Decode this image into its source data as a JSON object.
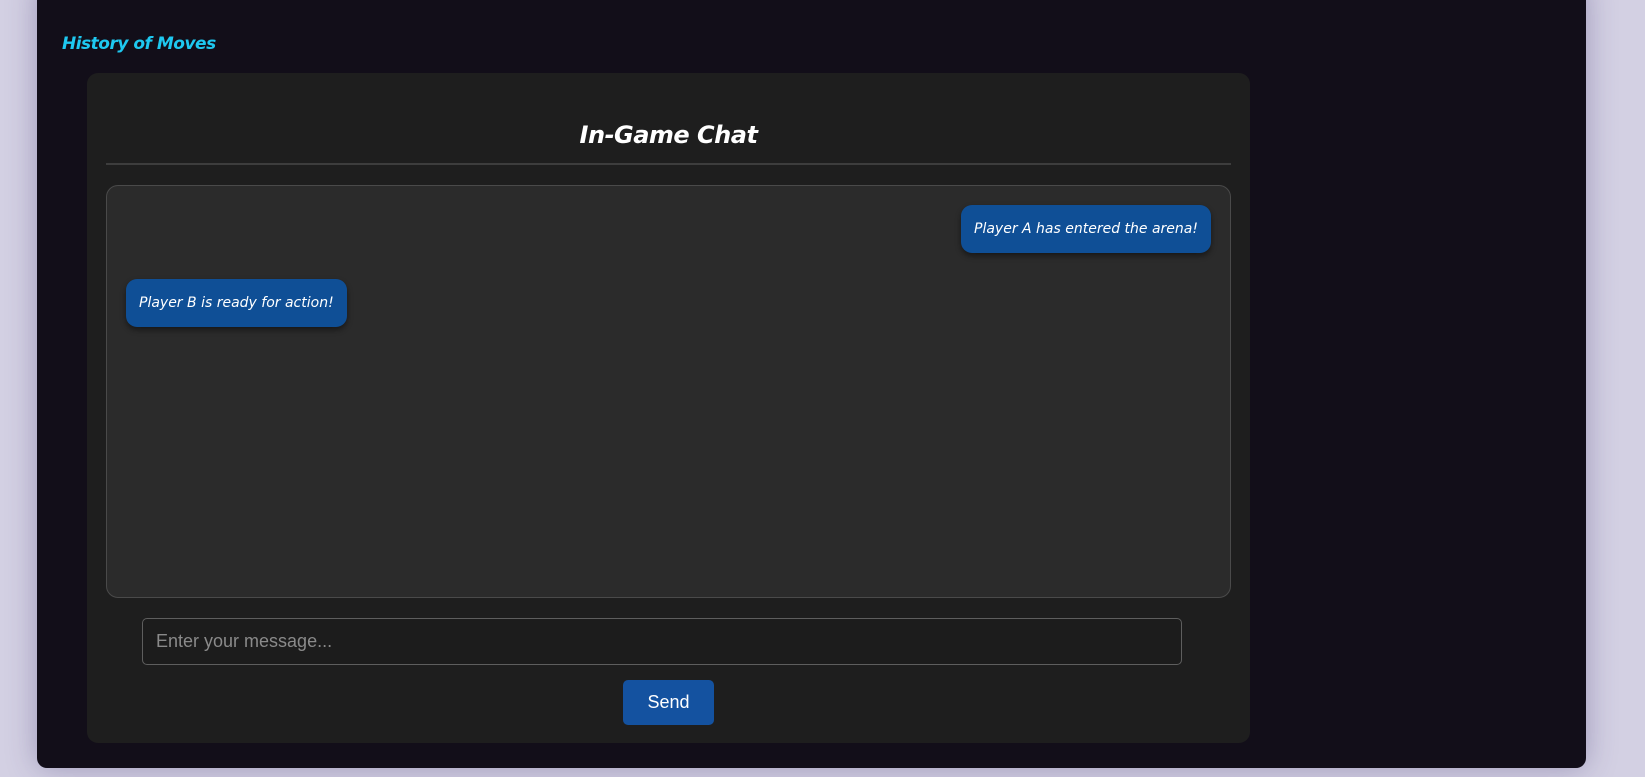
{
  "nav": {
    "history_label": "History of Moves"
  },
  "chat": {
    "title": "In-Game Chat",
    "messages": [
      {
        "sender": "Player A",
        "side": "right",
        "text": "Player A has entered the arena!"
      },
      {
        "sender": "Player B",
        "side": "left",
        "text": "Player B is ready for action!"
      }
    ],
    "input": {
      "value": "",
      "placeholder": "Enter your message..."
    },
    "send_label": "Send"
  },
  "colors": {
    "page_background": "#d3d0e3",
    "frame_background": "#120e19",
    "panel_background": "#1e1e1e",
    "messages_background": "#2b2b2b",
    "bubble": "#0f4f96",
    "accent_link": "#1ec8f0",
    "send_button": "#1452a0"
  }
}
